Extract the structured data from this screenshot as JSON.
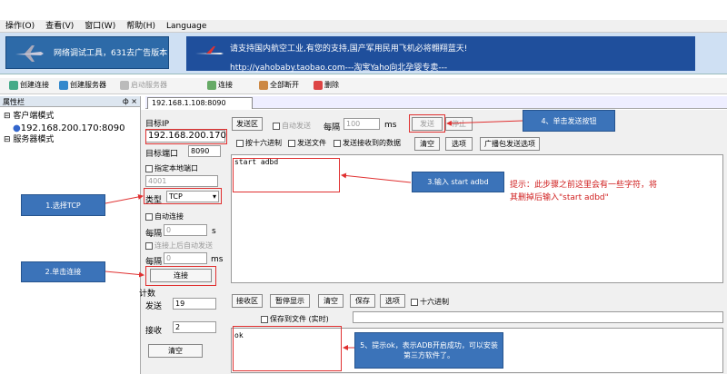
{
  "menu": [
    "操作(O)",
    "查看(V)",
    "窗口(W)",
    "帮助(H)",
    "Language"
  ],
  "banner": {
    "left_text": "网络调试工具，631去广告版本",
    "right_line1": "请支持国内航空工业,有您的支持,国产军用民用飞机必将翱翔蓝天!",
    "right_line2": "http://yahobaby.taobao.com---淘宝Yaho向北孕婴专卖---"
  },
  "toolbar": [
    "创建连接",
    "创建服务器",
    "启动服务器",
    "连接",
    "全部断开",
    "删除"
  ],
  "sidebar": {
    "title": "属性栏",
    "pin": "ф ×",
    "client_mode": "客户端模式",
    "client_ip": "192.168.200.170:8090",
    "server_mode": "服务器模式"
  },
  "tab": "192.168.1.108:8090",
  "left": {
    "target_ip_label": "目标IP",
    "target_ip": "192.168.200.170",
    "target_port_label": "目标端口",
    "target_port": "8090",
    "local_port_label": "指定本地端口",
    "local_port": "4001",
    "type_label": "类型",
    "type_value": "TCP",
    "auto_connect": "自动连接",
    "interval_label": "每隔",
    "interval1": "0",
    "unit_s": "s",
    "auto_send": "连接上后自动发送",
    "interval2": "0",
    "unit_ms": "ms",
    "connect_btn": "连接",
    "count_label": "计数",
    "send_label": "发送",
    "send_count": "19",
    "recv_label": "接收",
    "recv_count": "2",
    "clear_btn": "清空"
  },
  "send": {
    "area_label": "发送区",
    "auto_send": "自动发送",
    "every": "每隔",
    "every_val": "100",
    "ms": "ms",
    "send_btn": "发送",
    "stop_btn": "停止",
    "hex": "按十六进制",
    "send_file": "发送文件",
    "send_recv": "发送接收到的数据",
    "clear": "清空",
    "options": "选项",
    "broadcast": "广播包发送选项",
    "content": "start adbd"
  },
  "recv": {
    "area_label": "接收区",
    "pause": "暂停显示",
    "clear": "清空",
    "save": "保存",
    "options": "选项",
    "hex": "十六进制",
    "save_file": "保存到文件 (实时)",
    "content": "ok"
  },
  "callouts": {
    "c1": "1.选择TCP",
    "c2": "2.单击连接",
    "c3": "3.输入 start adbd",
    "c4": "4、单击发送按钮",
    "c5": "5、提示ok，表示ADB开启成功，可以安装第三方软件了。",
    "tip_line1": "提示：此步骤之前这里会有一些字符，将",
    "tip_line2": "其删掉后输入\"start adbd\""
  },
  "colors": {
    "callout": "#3b73b9",
    "annotation": "#e03030"
  }
}
